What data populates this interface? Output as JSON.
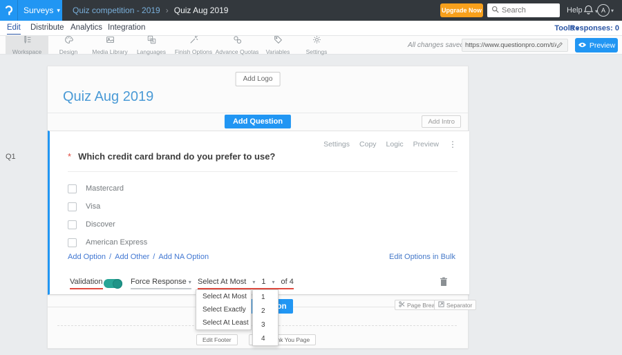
{
  "topbar": {
    "surveys_label": "Surveys",
    "breadcrumb_parent": "Quiz competition - 2019",
    "breadcrumb_current": "Quiz Aug 2019",
    "upgrade_label": "Upgrade Now",
    "search_placeholder": "Search",
    "help_label": "Help",
    "avatar_initial": "A"
  },
  "nav": {
    "tabs": [
      "Edit",
      "Distribute",
      "Analytics",
      "Integration"
    ],
    "active_tab": "Edit",
    "tools_label": "Tools",
    "responses_label": "Responses: 0"
  },
  "toolbar": {
    "items": [
      "Workspace",
      "Design",
      "Media Library",
      "Languages",
      "Finish Options",
      "Advance Quotas",
      "Variables",
      "Settings"
    ],
    "active_item": "Workspace",
    "saved_status": "All changes saved",
    "share_url": "https://www.questionpro.com/t/APNrFZ",
    "preview_label": "Preview"
  },
  "survey": {
    "add_logo_label": "Add Logo",
    "title": "Quiz Aug 2019",
    "add_question_label": "Add Question",
    "add_intro_label": "Add Intro",
    "question": {
      "id_label": "Q1",
      "required_marker": "*",
      "text": "Which credit card brand do you prefer to use?",
      "menu": [
        "Settings",
        "Copy",
        "Logic",
        "Preview"
      ],
      "options": [
        "Mastercard",
        "Visa",
        "Discover",
        "American Express"
      ],
      "option_links": [
        "Add Option",
        "Add Other",
        "Add NA Option"
      ],
      "link_separator": "/",
      "bulk_edit_label": "Edit Options in Bulk",
      "validation_label": "Validation",
      "force_response_label": "Force Response",
      "rule_selected": "Select At Most",
      "count_selected": "1",
      "of_label": "of 4"
    },
    "rule_dropdown": [
      "Select At Most",
      "Select Exactly",
      "Select At Least"
    ],
    "count_dropdown": [
      "1",
      "2",
      "3",
      "4"
    ],
    "footer": {
      "add_question_label": "Add Question",
      "page_break_label": "Page Break",
      "separator_label": "Separator",
      "edit_footer_label": "Edit Footer",
      "edit_thankyou_label": "Edit Thank You Page"
    }
  },
  "icons": {
    "caret_down": "▾",
    "more_vertical": "⋮",
    "breadcrumb_chevron": "›"
  },
  "colors": {
    "brand_blue": "#2196f3",
    "topbar_dark": "#33383d",
    "accent_orange": "#f7a01c",
    "toggle_teal": "#28a596",
    "alert_red": "#e04a3f",
    "title_blue": "#4a9ad6",
    "link_blue": "#4177d2"
  }
}
